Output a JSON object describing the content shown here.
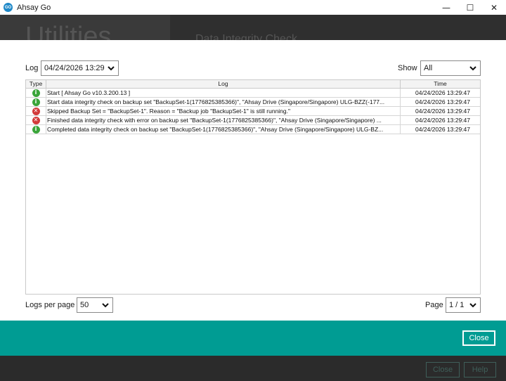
{
  "window": {
    "logo_text": "GO",
    "title": "Ahsay Go",
    "minimize": "—",
    "maximize": "☐",
    "close": "✕"
  },
  "background": {
    "heading": "Utilities",
    "subheading": "Data Integrity Check",
    "close_label": "Close",
    "help_label": "Help"
  },
  "filters": {
    "log_label": "Log",
    "log_value": "04/24/2026 13:29",
    "show_label": "Show",
    "show_value": "All"
  },
  "table": {
    "headers": {
      "type": "Type",
      "log": "Log",
      "time": "Time"
    },
    "rows": [
      {
        "type": "info",
        "icon": "i",
        "log": "Start [ Ahsay Go v10.3.200.13 ]",
        "time": "04/24/2026 13:29:47"
      },
      {
        "type": "info",
        "icon": "i",
        "log": "Start data integrity check on backup set \"BackupSet-1(1776825385366)\", \"Ahsay Drive (Singapore/Singapore) ULG-BZZ(-177...",
        "time": "04/24/2026 13:29:47"
      },
      {
        "type": "error",
        "icon": "✕",
        "log": "Skipped Backup Set = \"BackupSet-1\". Reason = \"Backup job \"BackupSet-1\" is still running.\"",
        "time": "04/24/2026 13:29:47"
      },
      {
        "type": "error",
        "icon": "✕",
        "log": "Finished data integrity check with error on backup set \"BackupSet-1(1776825385366)\", \"Ahsay Drive (Singapore/Singapore) ...",
        "time": "04/24/2026 13:29:47"
      },
      {
        "type": "info",
        "icon": "i",
        "log": "Completed data integrity check on backup set \"BackupSet-1(1776825385366)\", \"Ahsay Drive (Singapore/Singapore) ULG-BZ...",
        "time": "04/24/2026 13:29:47"
      }
    ]
  },
  "pagination": {
    "logs_per_page_label": "Logs per page",
    "logs_per_page_value": "50",
    "page_label": "Page",
    "page_value": "1 / 1"
  },
  "footer": {
    "close_label": "Close"
  },
  "colors": {
    "accent": "#009c93",
    "info": "#3aa53a",
    "error": "#d23a3a"
  }
}
